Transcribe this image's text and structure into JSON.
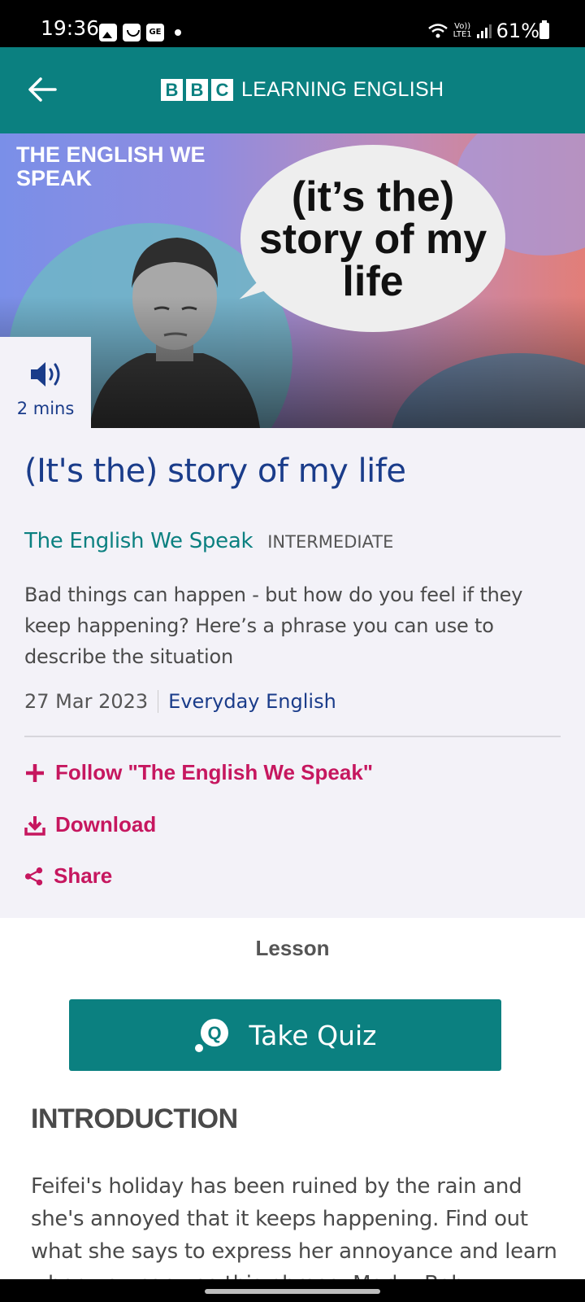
{
  "status_bar": {
    "time": "19:36",
    "network_top": "Vo))",
    "network_bottom": "LTE1",
    "battery_percent": "61%"
  },
  "app_bar": {
    "brand_letters": [
      "B",
      "B",
      "C"
    ],
    "brand_text": "LEARNING ENGLISH",
    "accent_color": "#0b8080"
  },
  "hero": {
    "series_title": "THE ENGLISH WE SPEAK",
    "bubble_text": "(it’s the) story of my life",
    "duration": "2 mins"
  },
  "episode": {
    "title": "(It's the) story of my life",
    "series": "The English We Speak",
    "level": "INTERMEDIATE",
    "description": "Bad things can happen - but how do you feel if they keep happening? Here’s a phrase you can use to describe the situation",
    "date": "27 Mar 2023",
    "category": "Everyday English"
  },
  "actions": {
    "follow": "Follow \"The English We Speak\"",
    "download": "Download",
    "share": "Share",
    "color": "#c6175f"
  },
  "lesson": {
    "tab_label": "Lesson",
    "quiz_button": "Take Quiz",
    "intro_heading": "INTRODUCTION",
    "intro_text": "Feifei's holiday has been ruined by the rain and she's annoyed that it keeps happening. Find out what she says to express her annoyance and learn when you can use this phrase. Mark - Bah"
  }
}
